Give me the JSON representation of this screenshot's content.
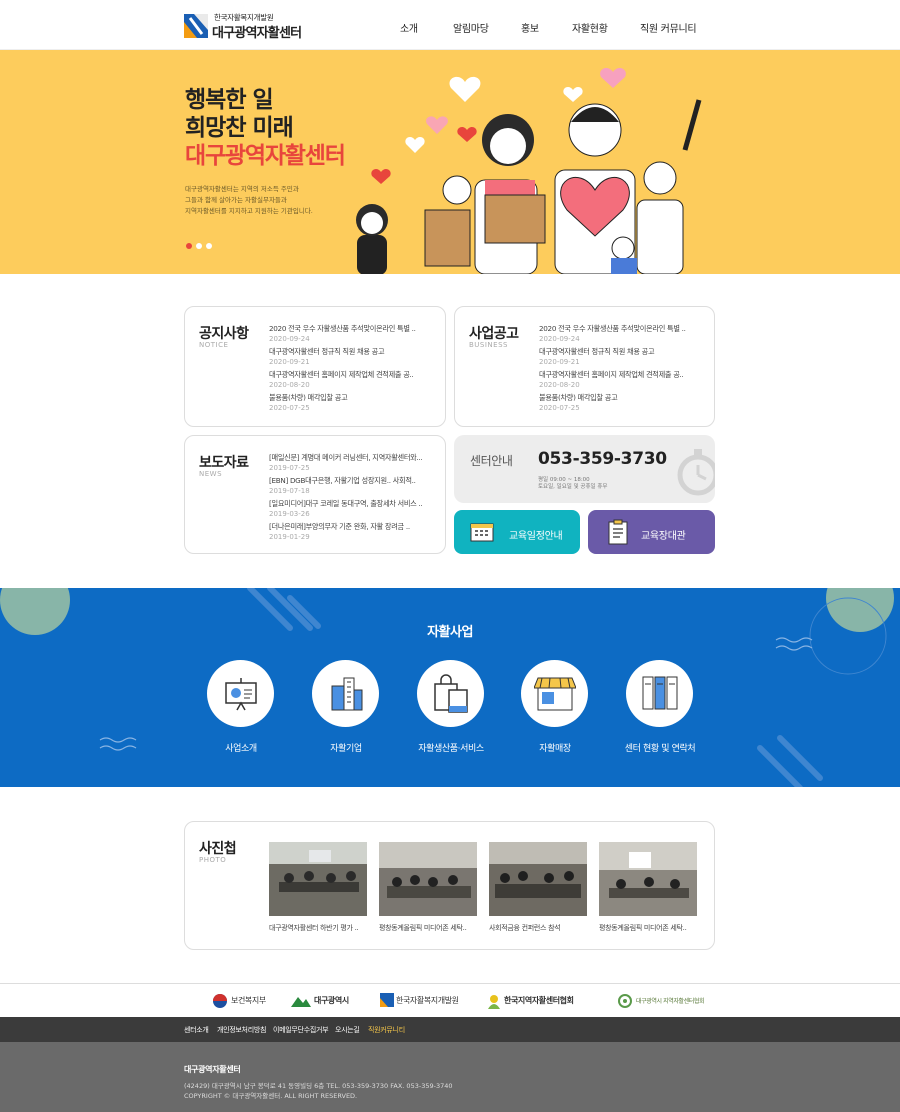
{
  "header": {
    "logo_small": "한국자활복지개발원",
    "logo_big": "대구광역자활센터",
    "nav": [
      "소개",
      "알림마당",
      "홍보",
      "자활현황",
      "직원 커뮤니티"
    ]
  },
  "hero": {
    "line1": "행복한 일",
    "line2": "희망찬 미래",
    "line3": "대구광역자활센터",
    "desc1": "대구광역자활센터는 지역의 저소득 주민과",
    "desc2": "그들과 함께 살아가는 자활실무자들과",
    "desc3": "지역자활센터를 지지하고 지원하는 기관입니다."
  },
  "notice": {
    "title": "공지사항",
    "sub": "NOTICE",
    "items": [
      {
        "title": "2020 전국 우수 자활생산품 추석맞이온라인 특별 ..",
        "date": "2020-09-24"
      },
      {
        "title": "대구광역자활센터 정규직 직원 채용 공고",
        "date": "2020-09-21"
      },
      {
        "title": "대구광역자활센터 홈페이지 제작업체 견적제출 공..",
        "date": "2020-08-20"
      },
      {
        "title": "불용품(차량) 매각입찰 공고",
        "date": "2020-07-25"
      }
    ]
  },
  "business": {
    "title": "사업공고",
    "sub": "BUSINESS",
    "items": [
      {
        "title": "2020 전국 우수 자활생산품 추석맞이온라인 특별 ..",
        "date": "2020-09-24"
      },
      {
        "title": "대구광역자활센터 정규직 직원 채용 공고",
        "date": "2020-09-21"
      },
      {
        "title": "대구광역자활센터 홈페이지 제작업체 견적제출 공..",
        "date": "2020-08-20"
      },
      {
        "title": "불용품(차량) 매각입찰 공고",
        "date": "2020-07-25"
      }
    ]
  },
  "news": {
    "title": "보도자료",
    "sub": "NEWS",
    "items": [
      {
        "title": "[매일신문] 계명대 메이커 러닝센터, 지역자활센터와...",
        "date": "2019-07-25"
      },
      {
        "title": "[EBN] DGB대구은행, 자활기업 성장지원.. 사회적..",
        "date": "2019-07-18"
      },
      {
        "title": "[일요미디어]대구 코레일 동대구역, 출장세차 서비스 ..",
        "date": "2019-03-26"
      },
      {
        "title": "[더나은미래]부양의무자 기준 완화, 자활 장려금 ..",
        "date": "2019-01-29"
      }
    ]
  },
  "center": {
    "title": "센터안내",
    "phone": "053-359-3730",
    "hours1": "평일 09:00 ~ 18:00",
    "hours2": "토요일, 일요일 및 공휴일 휴무"
  },
  "buttons": {
    "schedule": "교육일정안내",
    "register": "교육장대관"
  },
  "programs": {
    "title": "자활사업",
    "items": [
      "사업소개",
      "자활기업",
      "자활생산품·서비스",
      "자활매장",
      "센터 현황 및 연락처"
    ]
  },
  "photo": {
    "title": "사진첩",
    "sub": "PHOTO",
    "captions": [
      "대구광역자활센터 하반기 평가 ..",
      "평창동계올림픽 미디어존 세탁..",
      "사회적금융 컨퍼런스 참석",
      "평창동계올림픽 미디어존 세탁.."
    ]
  },
  "partners": [
    "보건복지부",
    "대구광역시",
    "한국자활복지개발원",
    "한국지역자활센터협회",
    "대구광역시 지역자활센터협회"
  ],
  "footer": {
    "links": [
      "센터소개",
      "개인정보처리방침",
      "이메일무단수집거부",
      "오시는길",
      "직원커뮤니티"
    ],
    "name": "대구광역자활센터",
    "address": "(42429) 대구광역시 남구 봉덕로 41 동영빌딩 6층   TEL. 053-359-3730   FAX. 053-359-3740",
    "copyright": "COPYRIGHT © 대구광역자활센터. ALL RIGHT RESERVED."
  },
  "colors": {
    "hero_bg": "#fdcc5c",
    "accent_red": "#e8453c",
    "blue": "#0d6bc4",
    "teal": "#10b3c0",
    "purple": "#6a5aa8",
    "footer_link_active": "#f4c64a"
  }
}
